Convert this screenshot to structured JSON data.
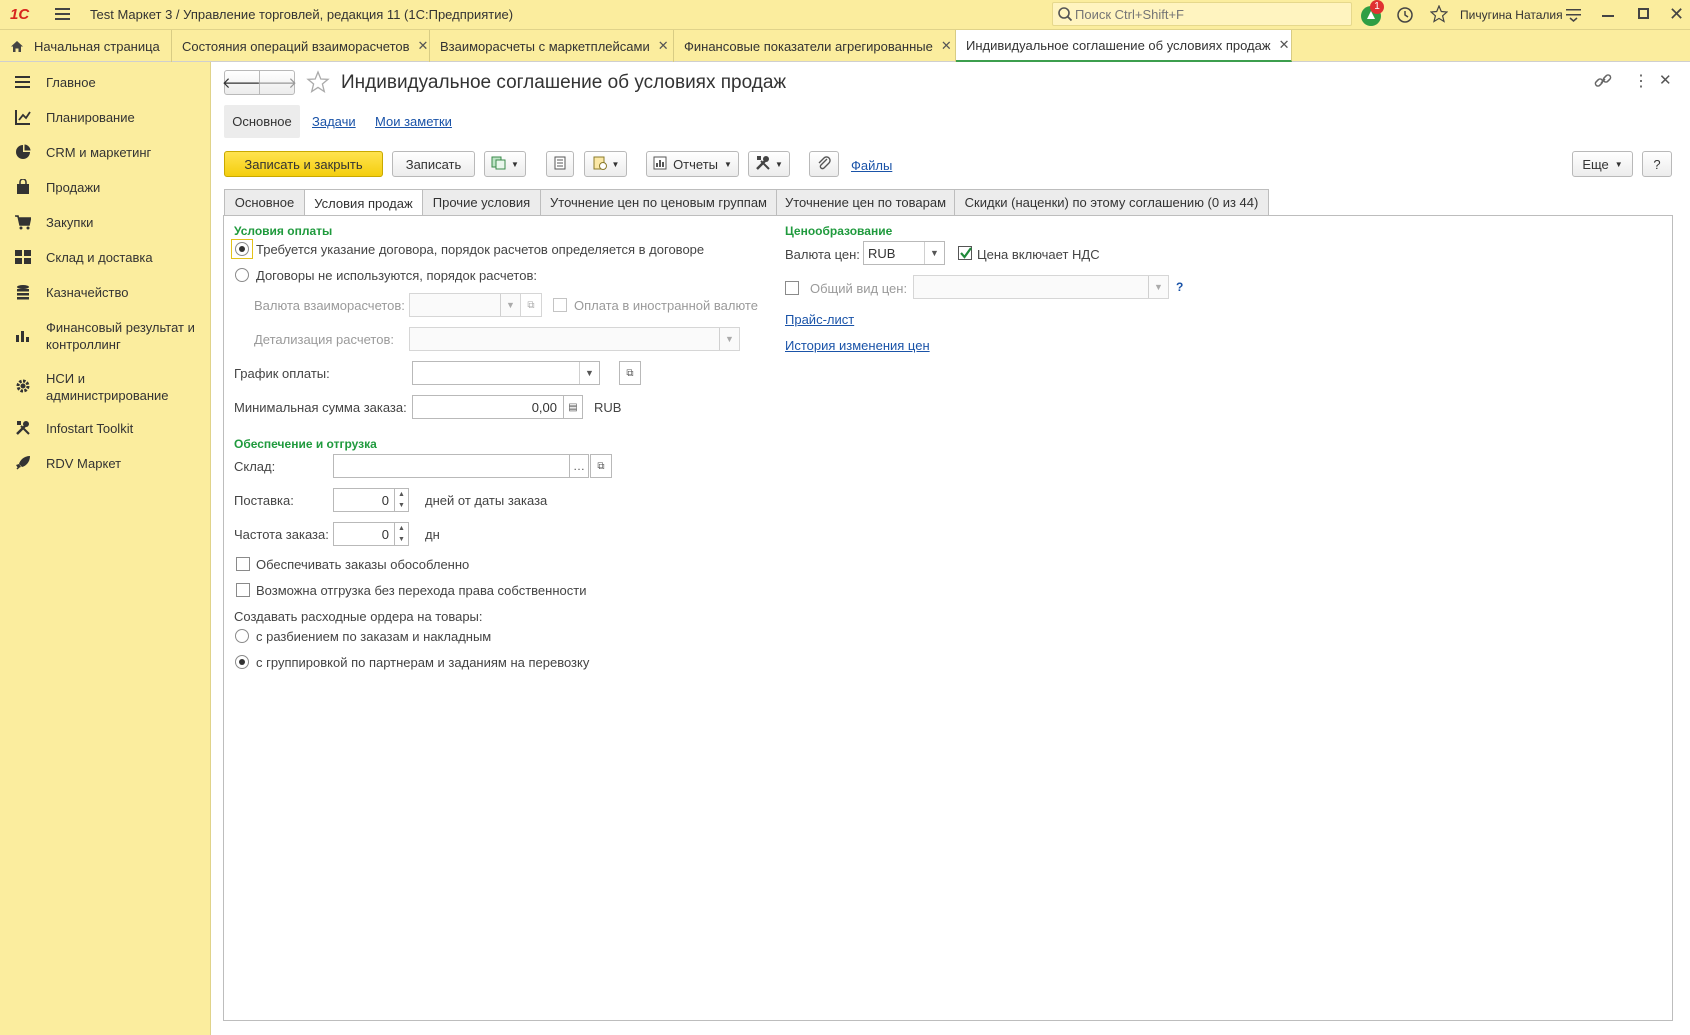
{
  "app": {
    "logo": "1С",
    "title": "Test Маркет 3 / Управление торговлей, редакция 11  (1С:Предприятие)",
    "search_placeholder": "Поиск Ctrl+Shift+F",
    "notification_count": "1",
    "user": "Пичугина Наталия"
  },
  "open_tabs": [
    {
      "label": "Начальная страница"
    },
    {
      "label": "Состояния операций взаиморасчетов"
    },
    {
      "label": "Взаиморасчеты с маркетплейсами"
    },
    {
      "label": "Финансовые показатели агрегированные"
    },
    {
      "label": "Индивидуальное соглашение об условиях продаж"
    }
  ],
  "sidebar": {
    "items": [
      {
        "label": "Главное",
        "icon": "menu-icon"
      },
      {
        "label": "Планирование",
        "icon": "planning-icon"
      },
      {
        "label": "CRM и маркетинг",
        "icon": "pie-chart-icon"
      },
      {
        "label": "Продажи",
        "icon": "shopping-bag-icon"
      },
      {
        "label": "Закупки",
        "icon": "cart-icon"
      },
      {
        "label": "Склад и доставка",
        "icon": "warehouse-icon"
      },
      {
        "label": "Казначейство",
        "icon": "coins-icon"
      },
      {
        "label": "Финансовый результат и контроллинг",
        "icon": "bar-chart-icon"
      },
      {
        "label": "НСИ и администрирование",
        "icon": "gear-icon"
      },
      {
        "label": "Infostart Toolkit",
        "icon": "tools-icon"
      },
      {
        "label": "RDV Маркет",
        "icon": "rocket-icon"
      }
    ]
  },
  "form": {
    "title": "Индивидуальное соглашение об условиях продаж",
    "nav": {
      "main": "Основное",
      "tasks": "Задачи",
      "notes": "Мои заметки"
    },
    "toolbar": {
      "save_close": "Записать и закрыть",
      "save": "Записать",
      "reports": "Отчеты",
      "files": "Файлы",
      "more": "Еще",
      "help": "?"
    },
    "tabs": [
      {
        "label": "Основное"
      },
      {
        "label": "Условия продаж"
      },
      {
        "label": "Прочие условия"
      },
      {
        "label": "Уточнение цен по ценовым группам"
      },
      {
        "label": "Уточнение цен по товарам"
      },
      {
        "label": "Скидки (наценки) по этому соглашению (0 из 44)"
      }
    ],
    "payment": {
      "section": "Условия оплаты",
      "radio_contract": "Требуется указание договора, порядок расчетов определяется в договоре",
      "radio_no_contract": "Договоры не используются, порядок расчетов:",
      "settlement_currency_label": "Валюта взаиморасчетов:",
      "foreign_currency_label": "Оплата в иностранной валюте",
      "detail_label": "Детализация расчетов:",
      "schedule_label": "График оплаты:",
      "min_sum_label": "Минимальная сумма заказа:",
      "min_sum_value": "0,00",
      "min_sum_currency": "RUB"
    },
    "shipping": {
      "section": "Обеспечение и отгрузка",
      "warehouse_label": "Склад:",
      "delivery_label": "Поставка:",
      "delivery_value": "0",
      "delivery_suffix": "дней от даты заказа",
      "frequency_label": "Частота заказа:",
      "frequency_value": "0",
      "frequency_suffix": "дн",
      "separate_label": "Обеспечивать заказы обособленно",
      "ownership_label": "Возможна отгрузка без перехода права собственности",
      "orders_label": "Создавать расходные ордера на товары:",
      "radio_split": "с разбиением по заказам и накладным",
      "radio_group": "с группировкой по партнерам и заданиям на перевозку"
    },
    "pricing": {
      "section": "Ценообразование",
      "currency_label": "Валюта цен:",
      "currency_value": "RUB",
      "vat_label": "Цена включает НДС",
      "general_price_label": "Общий вид цен:",
      "general_price_help": "?",
      "price_list_link": "Прайс-лист",
      "history_link": "История изменения цен"
    }
  }
}
